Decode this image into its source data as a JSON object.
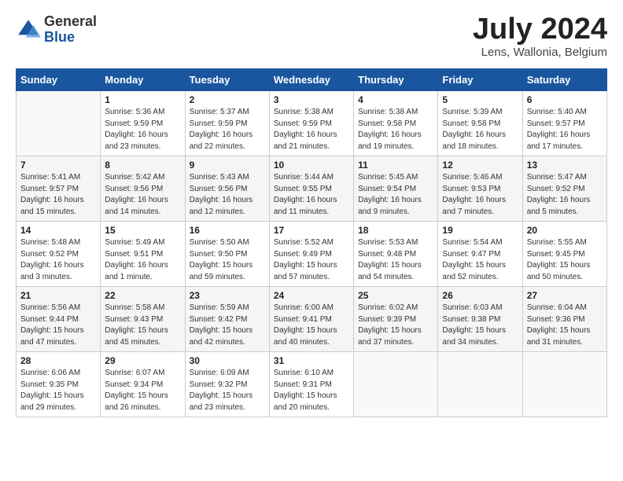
{
  "header": {
    "logo_general": "General",
    "logo_blue": "Blue",
    "month_title": "July 2024",
    "location": "Lens, Wallonia, Belgium"
  },
  "days_of_week": [
    "Sunday",
    "Monday",
    "Tuesday",
    "Wednesday",
    "Thursday",
    "Friday",
    "Saturday"
  ],
  "weeks": [
    [
      {
        "num": "",
        "info": ""
      },
      {
        "num": "1",
        "info": "Sunrise: 5:36 AM\nSunset: 9:59 PM\nDaylight: 16 hours\nand 23 minutes."
      },
      {
        "num": "2",
        "info": "Sunrise: 5:37 AM\nSunset: 9:59 PM\nDaylight: 16 hours\nand 22 minutes."
      },
      {
        "num": "3",
        "info": "Sunrise: 5:38 AM\nSunset: 9:59 PM\nDaylight: 16 hours\nand 21 minutes."
      },
      {
        "num": "4",
        "info": "Sunrise: 5:38 AM\nSunset: 9:58 PM\nDaylight: 16 hours\nand 19 minutes."
      },
      {
        "num": "5",
        "info": "Sunrise: 5:39 AM\nSunset: 9:58 PM\nDaylight: 16 hours\nand 18 minutes."
      },
      {
        "num": "6",
        "info": "Sunrise: 5:40 AM\nSunset: 9:57 PM\nDaylight: 16 hours\nand 17 minutes."
      }
    ],
    [
      {
        "num": "7",
        "info": "Sunrise: 5:41 AM\nSunset: 9:57 PM\nDaylight: 16 hours\nand 15 minutes."
      },
      {
        "num": "8",
        "info": "Sunrise: 5:42 AM\nSunset: 9:56 PM\nDaylight: 16 hours\nand 14 minutes."
      },
      {
        "num": "9",
        "info": "Sunrise: 5:43 AM\nSunset: 9:56 PM\nDaylight: 16 hours\nand 12 minutes."
      },
      {
        "num": "10",
        "info": "Sunrise: 5:44 AM\nSunset: 9:55 PM\nDaylight: 16 hours\nand 11 minutes."
      },
      {
        "num": "11",
        "info": "Sunrise: 5:45 AM\nSunset: 9:54 PM\nDaylight: 16 hours\nand 9 minutes."
      },
      {
        "num": "12",
        "info": "Sunrise: 5:46 AM\nSunset: 9:53 PM\nDaylight: 16 hours\nand 7 minutes."
      },
      {
        "num": "13",
        "info": "Sunrise: 5:47 AM\nSunset: 9:52 PM\nDaylight: 16 hours\nand 5 minutes."
      }
    ],
    [
      {
        "num": "14",
        "info": "Sunrise: 5:48 AM\nSunset: 9:52 PM\nDaylight: 16 hours\nand 3 minutes."
      },
      {
        "num": "15",
        "info": "Sunrise: 5:49 AM\nSunset: 9:51 PM\nDaylight: 16 hours\nand 1 minute."
      },
      {
        "num": "16",
        "info": "Sunrise: 5:50 AM\nSunset: 9:50 PM\nDaylight: 15 hours\nand 59 minutes."
      },
      {
        "num": "17",
        "info": "Sunrise: 5:52 AM\nSunset: 9:49 PM\nDaylight: 15 hours\nand 57 minutes."
      },
      {
        "num": "18",
        "info": "Sunrise: 5:53 AM\nSunset: 9:48 PM\nDaylight: 15 hours\nand 54 minutes."
      },
      {
        "num": "19",
        "info": "Sunrise: 5:54 AM\nSunset: 9:47 PM\nDaylight: 15 hours\nand 52 minutes."
      },
      {
        "num": "20",
        "info": "Sunrise: 5:55 AM\nSunset: 9:45 PM\nDaylight: 15 hours\nand 50 minutes."
      }
    ],
    [
      {
        "num": "21",
        "info": "Sunrise: 5:56 AM\nSunset: 9:44 PM\nDaylight: 15 hours\nand 47 minutes."
      },
      {
        "num": "22",
        "info": "Sunrise: 5:58 AM\nSunset: 9:43 PM\nDaylight: 15 hours\nand 45 minutes."
      },
      {
        "num": "23",
        "info": "Sunrise: 5:59 AM\nSunset: 9:42 PM\nDaylight: 15 hours\nand 42 minutes."
      },
      {
        "num": "24",
        "info": "Sunrise: 6:00 AM\nSunset: 9:41 PM\nDaylight: 15 hours\nand 40 minutes."
      },
      {
        "num": "25",
        "info": "Sunrise: 6:02 AM\nSunset: 9:39 PM\nDaylight: 15 hours\nand 37 minutes."
      },
      {
        "num": "26",
        "info": "Sunrise: 6:03 AM\nSunset: 9:38 PM\nDaylight: 15 hours\nand 34 minutes."
      },
      {
        "num": "27",
        "info": "Sunrise: 6:04 AM\nSunset: 9:36 PM\nDaylight: 15 hours\nand 31 minutes."
      }
    ],
    [
      {
        "num": "28",
        "info": "Sunrise: 6:06 AM\nSunset: 9:35 PM\nDaylight: 15 hours\nand 29 minutes."
      },
      {
        "num": "29",
        "info": "Sunrise: 6:07 AM\nSunset: 9:34 PM\nDaylight: 15 hours\nand 26 minutes."
      },
      {
        "num": "30",
        "info": "Sunrise: 6:09 AM\nSunset: 9:32 PM\nDaylight: 15 hours\nand 23 minutes."
      },
      {
        "num": "31",
        "info": "Sunrise: 6:10 AM\nSunset: 9:31 PM\nDaylight: 15 hours\nand 20 minutes."
      },
      {
        "num": "",
        "info": ""
      },
      {
        "num": "",
        "info": ""
      },
      {
        "num": "",
        "info": ""
      }
    ]
  ]
}
